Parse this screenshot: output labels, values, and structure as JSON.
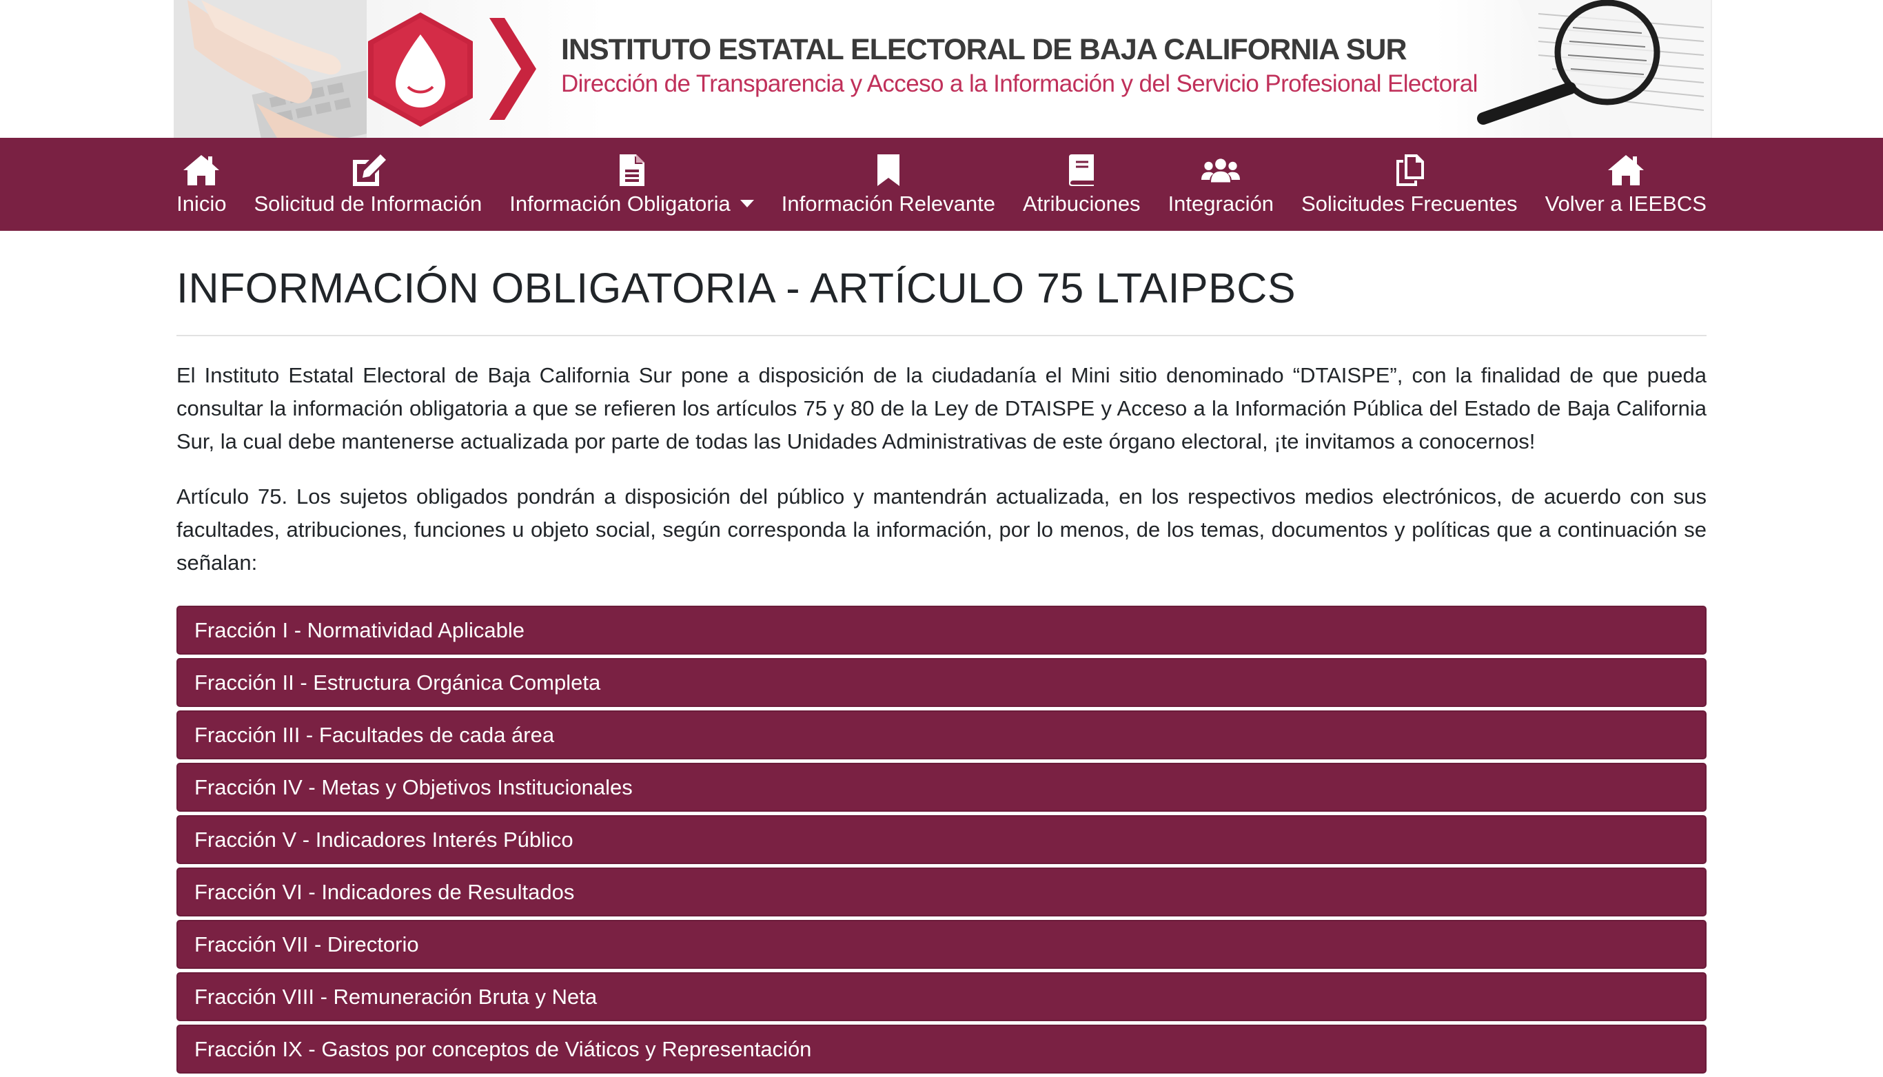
{
  "banner": {
    "title": "INSTITUTO ESTATAL ELECTORAL DE BAJA CALIFORNIA SUR",
    "subtitle": "Dirección de Transparencia y Acceso a la Información y del Servicio Profesional Electoral",
    "colors": {
      "accent": "#c0305a",
      "logo": "#c8243f"
    }
  },
  "nav": {
    "background": "#7a2143",
    "items": [
      {
        "label": "Inicio",
        "icon": "home-icon"
      },
      {
        "label": "Solicitud de Información",
        "icon": "edit-icon"
      },
      {
        "label": "Información Obligatoria",
        "icon": "file-text-icon",
        "dropdown": true
      },
      {
        "label": "Información Relevante",
        "icon": "bookmark-icon"
      },
      {
        "label": "Atribuciones",
        "icon": "book-icon"
      },
      {
        "label": "Integración",
        "icon": "users-icon"
      },
      {
        "label": "Solicitudes Frecuentes",
        "icon": "copy-icon"
      },
      {
        "label": "Volver a IEEBCS",
        "icon": "home-icon"
      }
    ]
  },
  "main": {
    "title": "INFORMACIÓN OBLIGATORIA - ARTÍCULO 75 LTAIPBCS",
    "paragraphs": [
      "El Instituto Estatal Electoral de Baja California Sur pone a disposición de la ciudadanía el Mini sitio denominado “DTAISPE”, con la finalidad de que pueda consultar la información obligatoria a que se refieren los artículos 75 y 80 de la Ley de DTAISPE y Acceso a la Información Pública del Estado de Baja California Sur, la cual debe mantenerse actualizada por parte de todas las Unidades Administrativas de este órgano electoral, ¡te invitamos a conocernos!",
      "Artículo 75. Los sujetos obligados pondrán a disposición del público y mantendrán actualizada, en los respectivos medios electrónicos, de acuerdo con sus facultades, atribuciones, funciones u objeto social, según corresponda la información, por lo menos, de los temas, documentos y políticas que a continuación se señalan:"
    ],
    "fracciones": [
      "Fracción I - Normatividad Aplicable",
      "Fracción II - Estructura Orgánica Completa",
      "Fracción III - Facultades de cada área",
      "Fracción IV - Metas y Objetivos Institucionales",
      "Fracción V - Indicadores Interés Público",
      "Fracción VI - Indicadores de Resultados",
      "Fracción VII - Directorio",
      "Fracción VIII - Remuneración Bruta y Neta",
      "Fracción IX - Gastos por conceptos de Viáticos y Representación"
    ]
  }
}
